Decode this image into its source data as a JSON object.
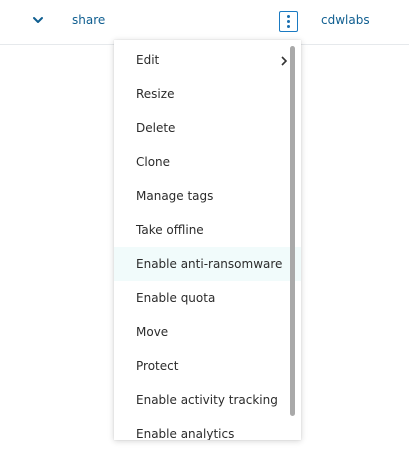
{
  "header": {
    "expand_icon": "chevron-down-icon",
    "share_name": "share",
    "actions_icon": "vertical-ellipsis-icon",
    "owner": "cdwlabs"
  },
  "menu": {
    "hovered_item": "Enable anti-ransomware",
    "items": [
      {
        "label": "Edit",
        "has_submenu": true
      },
      {
        "label": "Resize"
      },
      {
        "label": "Delete"
      },
      {
        "label": "Clone"
      },
      {
        "label": "Manage tags"
      },
      {
        "label": "Take offline"
      },
      {
        "label": "Enable anti-ransomware"
      },
      {
        "label": "Enable quota"
      },
      {
        "label": "Move"
      },
      {
        "label": "Protect"
      },
      {
        "label": "Enable activity tracking"
      },
      {
        "label": "Enable analytics"
      }
    ]
  },
  "colors": {
    "link": "#0f5e90",
    "accent_border": "#1a7ac2",
    "hover_background": "#f1fbfb",
    "menu_text": "#2b2b2b",
    "scroll_thumb": "#a9a9a9"
  }
}
